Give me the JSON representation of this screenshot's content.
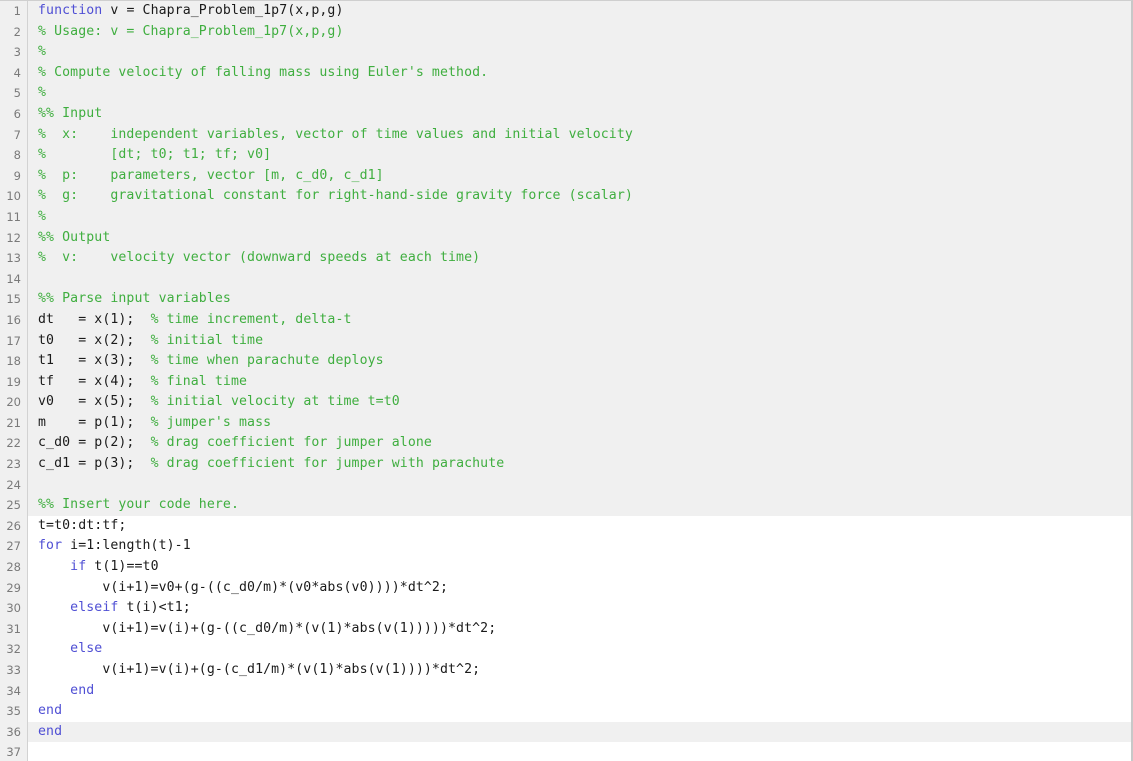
{
  "editor": {
    "name": "matlab-code-editor",
    "colors": {
      "comment": "#3fae3f",
      "keyword": "#4f4fd4",
      "plain": "#1a1a1a",
      "gutter_text": "#7a7a7a",
      "gutter_bg": "#f0f0f0",
      "shaded_row_bg": "#f0f0f0",
      "plain_row_bg": "#ffffff",
      "current_line_bg": "#f0f0f0",
      "border": "#c8c8c8"
    },
    "total_lines_visible": 37,
    "current_line": 36,
    "lines": [
      {
        "n": "1",
        "shade": "shaded",
        "tokens": [
          {
            "t": "keyword",
            "s": "function"
          },
          {
            "t": "plain",
            "s": " v = Chapra_Problem_1p7(x,p,g)"
          }
        ]
      },
      {
        "n": "2",
        "shade": "shaded",
        "tokens": [
          {
            "t": "comment",
            "s": "% Usage: v = Chapra_Problem_1p7(x,p,g)"
          }
        ]
      },
      {
        "n": "3",
        "shade": "shaded",
        "tokens": [
          {
            "t": "comment",
            "s": "%"
          }
        ]
      },
      {
        "n": "4",
        "shade": "shaded",
        "tokens": [
          {
            "t": "comment",
            "s": "% Compute velocity of falling mass using Euler's method."
          }
        ]
      },
      {
        "n": "5",
        "shade": "shaded",
        "tokens": [
          {
            "t": "comment",
            "s": "%"
          }
        ]
      },
      {
        "n": "6",
        "shade": "shaded",
        "tokens": [
          {
            "t": "comment",
            "s": "%% Input"
          }
        ]
      },
      {
        "n": "7",
        "shade": "shaded",
        "tokens": [
          {
            "t": "comment",
            "s": "%  x:    independent variables, vector of time values and initial velocity"
          }
        ]
      },
      {
        "n": "8",
        "shade": "shaded",
        "tokens": [
          {
            "t": "comment",
            "s": "%        [dt; t0; t1; tf; v0]"
          }
        ]
      },
      {
        "n": "9",
        "shade": "shaded",
        "tokens": [
          {
            "t": "comment",
            "s": "%  p:    parameters, vector [m, c_d0, c_d1]"
          }
        ]
      },
      {
        "n": "10",
        "shade": "shaded",
        "tokens": [
          {
            "t": "comment",
            "s": "%  g:    gravitational constant for right-hand-side gravity force (scalar)"
          }
        ]
      },
      {
        "n": "11",
        "shade": "shaded",
        "tokens": [
          {
            "t": "comment",
            "s": "%"
          }
        ]
      },
      {
        "n": "12",
        "shade": "shaded",
        "tokens": [
          {
            "t": "comment",
            "s": "%% Output"
          }
        ]
      },
      {
        "n": "13",
        "shade": "shaded",
        "tokens": [
          {
            "t": "comment",
            "s": "%  v:    velocity vector (downward speeds at each time)"
          }
        ]
      },
      {
        "n": "14",
        "shade": "shaded",
        "tokens": [
          {
            "t": "plain",
            "s": ""
          }
        ]
      },
      {
        "n": "15",
        "shade": "shaded",
        "tokens": [
          {
            "t": "comment",
            "s": "%% Parse input variables"
          }
        ]
      },
      {
        "n": "16",
        "shade": "shaded",
        "tokens": [
          {
            "t": "plain",
            "s": "dt   = x(1);  "
          },
          {
            "t": "comment",
            "s": "% time increment, delta-t"
          }
        ]
      },
      {
        "n": "17",
        "shade": "shaded",
        "tokens": [
          {
            "t": "plain",
            "s": "t0   = x(2);  "
          },
          {
            "t": "comment",
            "s": "% initial time"
          }
        ]
      },
      {
        "n": "18",
        "shade": "shaded",
        "tokens": [
          {
            "t": "plain",
            "s": "t1   = x(3);  "
          },
          {
            "t": "comment",
            "s": "% time when parachute deploys"
          }
        ]
      },
      {
        "n": "19",
        "shade": "shaded",
        "tokens": [
          {
            "t": "plain",
            "s": "tf   = x(4);  "
          },
          {
            "t": "comment",
            "s": "% final time"
          }
        ]
      },
      {
        "n": "20",
        "shade": "shaded",
        "tokens": [
          {
            "t": "plain",
            "s": "v0   = x(5);  "
          },
          {
            "t": "comment",
            "s": "% initial velocity at time t=t0"
          }
        ]
      },
      {
        "n": "21",
        "shade": "shaded",
        "tokens": [
          {
            "t": "plain",
            "s": "m    = p(1);  "
          },
          {
            "t": "comment",
            "s": "% jumper's mass"
          }
        ]
      },
      {
        "n": "22",
        "shade": "shaded",
        "tokens": [
          {
            "t": "plain",
            "s": "c_d0 = p(2);  "
          },
          {
            "t": "comment",
            "s": "% drag coefficient for jumper alone"
          }
        ]
      },
      {
        "n": "23",
        "shade": "shaded",
        "tokens": [
          {
            "t": "plain",
            "s": "c_d1 = p(3);  "
          },
          {
            "t": "comment",
            "s": "% drag coefficient for jumper with parachute"
          }
        ]
      },
      {
        "n": "24",
        "shade": "shaded",
        "tokens": [
          {
            "t": "plain",
            "s": ""
          }
        ]
      },
      {
        "n": "25",
        "shade": "shaded",
        "tokens": [
          {
            "t": "comment",
            "s": "%% Insert your code here."
          }
        ]
      },
      {
        "n": "26",
        "shade": "plain",
        "tokens": [
          {
            "t": "plain",
            "s": "t=t0:dt:tf;"
          }
        ]
      },
      {
        "n": "27",
        "shade": "plain",
        "tokens": [
          {
            "t": "keyword",
            "s": "for"
          },
          {
            "t": "plain",
            "s": " i=1:length(t)-1"
          }
        ]
      },
      {
        "n": "28",
        "shade": "plain",
        "tokens": [
          {
            "t": "plain",
            "s": "    "
          },
          {
            "t": "keyword",
            "s": "if"
          },
          {
            "t": "plain",
            "s": " t(1)==t0"
          }
        ]
      },
      {
        "n": "29",
        "shade": "plain",
        "tokens": [
          {
            "t": "plain",
            "s": "        v(i+1)=v0+(g-((c_d0/m)*(v0*abs(v0))))*dt^2;"
          }
        ]
      },
      {
        "n": "30",
        "shade": "plain",
        "tokens": [
          {
            "t": "plain",
            "s": "    "
          },
          {
            "t": "keyword",
            "s": "elseif"
          },
          {
            "t": "plain",
            "s": " t(i)<t1;"
          }
        ]
      },
      {
        "n": "31",
        "shade": "plain",
        "tokens": [
          {
            "t": "plain",
            "s": "        v(i+1)=v(i)+(g-((c_d0/m)*(v(1)*abs(v(1)))))*dt^2;"
          }
        ]
      },
      {
        "n": "32",
        "shade": "plain",
        "tokens": [
          {
            "t": "plain",
            "s": "    "
          },
          {
            "t": "keyword",
            "s": "else"
          }
        ]
      },
      {
        "n": "33",
        "shade": "plain",
        "tokens": [
          {
            "t": "plain",
            "s": "        v(i+1)=v(i)+(g-(c_d1/m)*(v(1)*abs(v(1))))*dt^2;"
          }
        ]
      },
      {
        "n": "34",
        "shade": "plain",
        "tokens": [
          {
            "t": "plain",
            "s": "    "
          },
          {
            "t": "keyword",
            "s": "end"
          }
        ]
      },
      {
        "n": "35",
        "shade": "plain",
        "tokens": [
          {
            "t": "keyword",
            "s": "end"
          }
        ]
      },
      {
        "n": "36",
        "shade": "current",
        "tokens": [
          {
            "t": "keyword",
            "s": "end"
          }
        ]
      },
      {
        "n": "37",
        "shade": "plain",
        "tokens": [
          {
            "t": "plain",
            "s": ""
          }
        ]
      }
    ]
  }
}
